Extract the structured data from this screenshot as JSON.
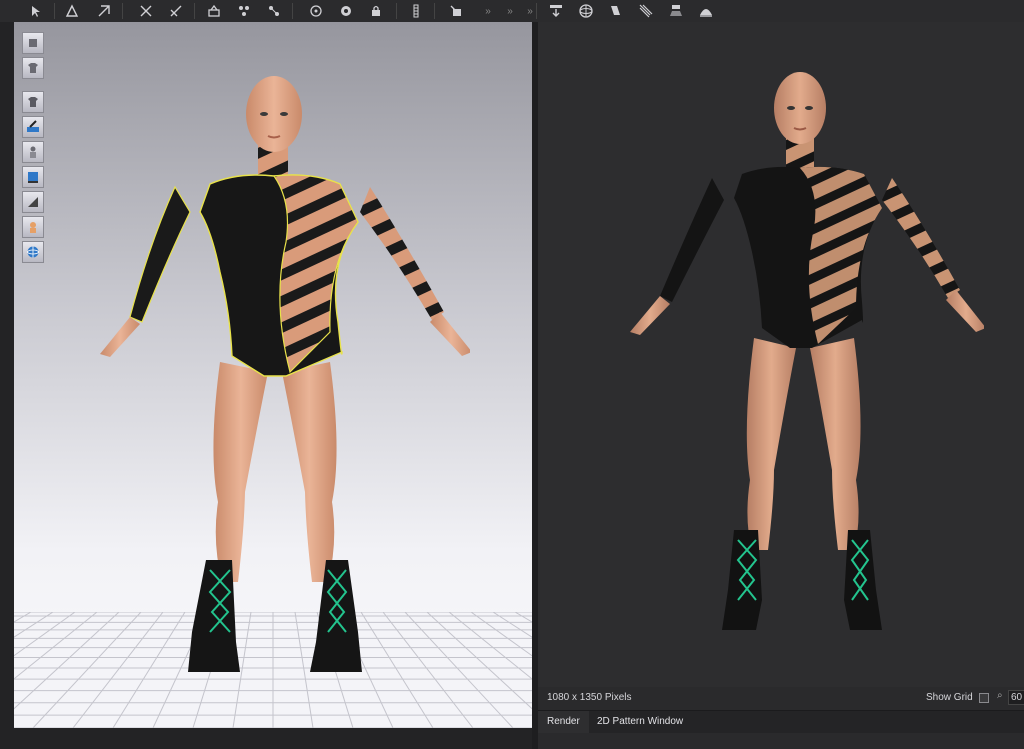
{
  "toolbar": {
    "icons": [
      "select-move-icon",
      "pattern-edit-icon",
      "transform-icon",
      "sewing-icon",
      "segment-sewing-icon",
      "fold-icon",
      "pin-icon",
      "tack-icon",
      "measure-icon",
      "avatar-measure-icon",
      "more-icon",
      "render-icon",
      "sphere-icon",
      "light-icon",
      "lights-arrows-icon",
      "spotlight-icon",
      "dome-light-icon"
    ],
    "overflow": "»"
  },
  "viewport_tools": [
    "avatar-icon",
    "garment-icon",
    "texture-icon",
    "brush-icon",
    "mannequin-icon",
    "display-icon",
    "shader-icon",
    "skin-icon",
    "globe-icon"
  ],
  "render_window": {
    "resolution": "1080 x 1350 Pixels",
    "show_grid_label": "Show Grid",
    "zoom": "60"
  },
  "tabs": [
    {
      "label": "Render",
      "active": true
    },
    {
      "label": "2D Pattern Window",
      "active": false
    }
  ],
  "colors": {
    "ui_dark": "#2a2a2c",
    "viewport_top": "#96969e",
    "viewport_bottom": "#fafafc",
    "outline_yellow": "#e8e24a",
    "lace_green": "#23c48e",
    "skin": "#e2ab8c"
  }
}
